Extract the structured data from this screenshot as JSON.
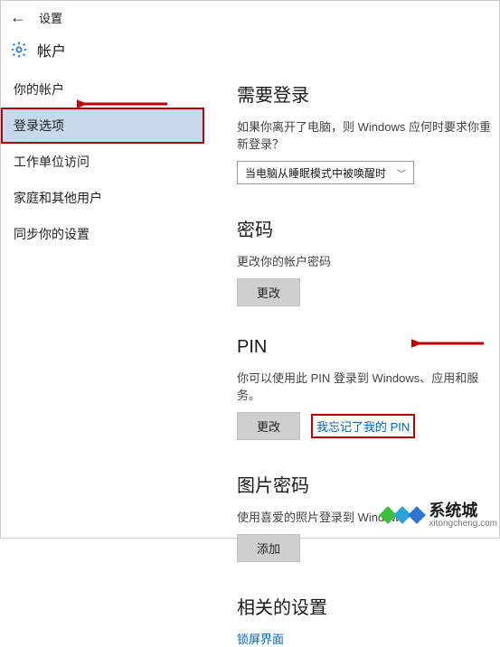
{
  "topbar": {
    "title": "设置"
  },
  "header": {
    "title": "帐户"
  },
  "sidebar": {
    "items": [
      {
        "label": "你的帐户"
      },
      {
        "label": "登录选项"
      },
      {
        "label": "工作单位访问"
      },
      {
        "label": "家庭和其他用户"
      },
      {
        "label": "同步你的设置"
      }
    ]
  },
  "sections": {
    "signin": {
      "heading": "需要登录",
      "desc": "如果你离开了电脑，则 Windows 应何时要求你重新登录？",
      "dropdown_value": "当电脑从睡眠模式中被唤醒时"
    },
    "password": {
      "heading": "密码",
      "desc": "更改你的帐户密码",
      "btn": "更改"
    },
    "pin": {
      "heading": "PIN",
      "desc": "你可以使用此 PIN 登录到 Windows、应用和服务。",
      "btn": "更改",
      "forgot_link": "我忘记了我的 PIN"
    },
    "picture": {
      "heading": "图片密码",
      "desc": "使用喜爱的照片登录到 Windows",
      "btn": "添加"
    },
    "related": {
      "heading": "相关的设置",
      "link": "锁屏界面"
    }
  },
  "watermark": {
    "cn": "系统城",
    "en": "xitongcheng.com"
  }
}
